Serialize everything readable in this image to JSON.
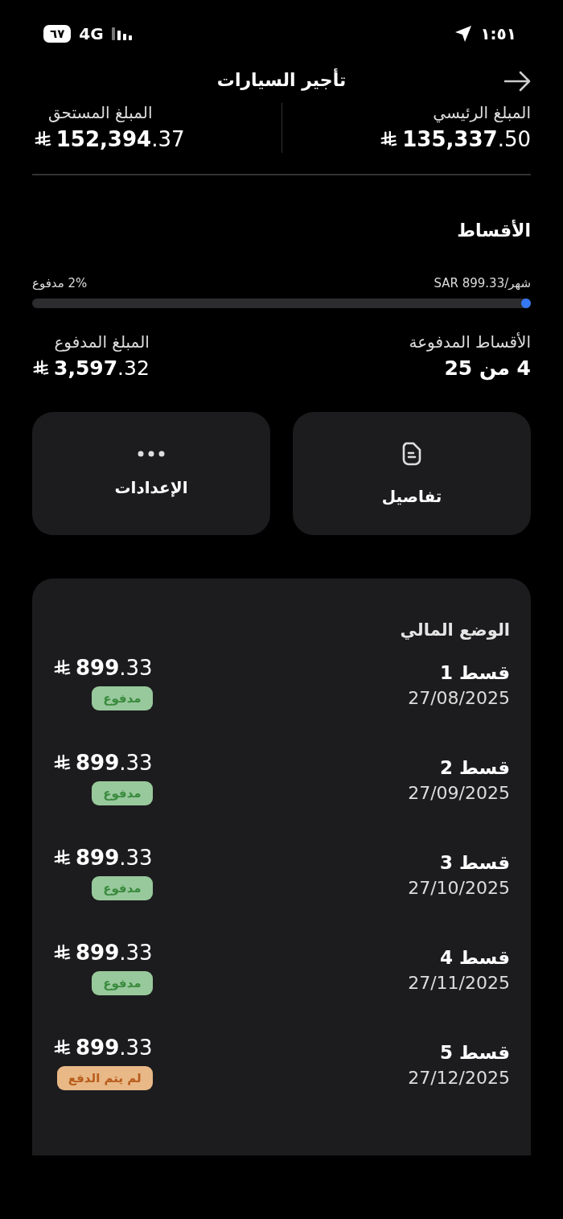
{
  "status_bar": {
    "battery": "٦٧",
    "network": "4G",
    "time": "١:٥١"
  },
  "header": {
    "title": "تأجير السيارات"
  },
  "summary": [
    {
      "label": "المبلغ الرئيسي",
      "amount": "**135,337**.50"
    },
    {
      "label": "المبلغ المستحق",
      "amount": "**152,394**.37"
    }
  ],
  "installments": {
    "title": "الأقساط",
    "monthly": "شهر/SAR 899.33",
    "paid_percent": "2% مدفوع",
    "level": 0.02,
    "stats": [
      {
        "label": "الأقساط المدفوعة",
        "value": "4 من 25",
        "kind": "count"
      },
      {
        "label": "المبلغ المدفوع",
        "value": "**3,597**.32",
        "kind": "money"
      }
    ]
  },
  "actions": [
    {
      "label": "تفاصيل",
      "kind": "document"
    },
    {
      "label": "الإعدادات",
      "kind": "more"
    }
  ],
  "financial_status": {
    "title": "الوضع المالي",
    "rows": [
      {
        "name": "قسط 1",
        "date": "27/08/2025",
        "amount": "**899**.33",
        "status": {
          "label": "مدفوع",
          "kind": "paid"
        }
      },
      {
        "name": "قسط 2",
        "date": "27/09/2025",
        "amount": "**899**.33",
        "status": {
          "label": "مدفوع",
          "kind": "paid"
        }
      },
      {
        "name": "قسط 3",
        "date": "27/10/2025",
        "amount": "**899**.33",
        "status": {
          "label": "مدفوع",
          "kind": "paid"
        }
      },
      {
        "name": "قسط 4",
        "date": "27/11/2025",
        "amount": "**899**.33",
        "status": {
          "label": "مدفوع",
          "kind": "paid"
        }
      },
      {
        "name": "قسط 5",
        "date": "27/12/2025",
        "amount": "**899**.33",
        "status": {
          "label": "لم يتم الدفع",
          "kind": "unpaid"
        }
      }
    ]
  }
}
